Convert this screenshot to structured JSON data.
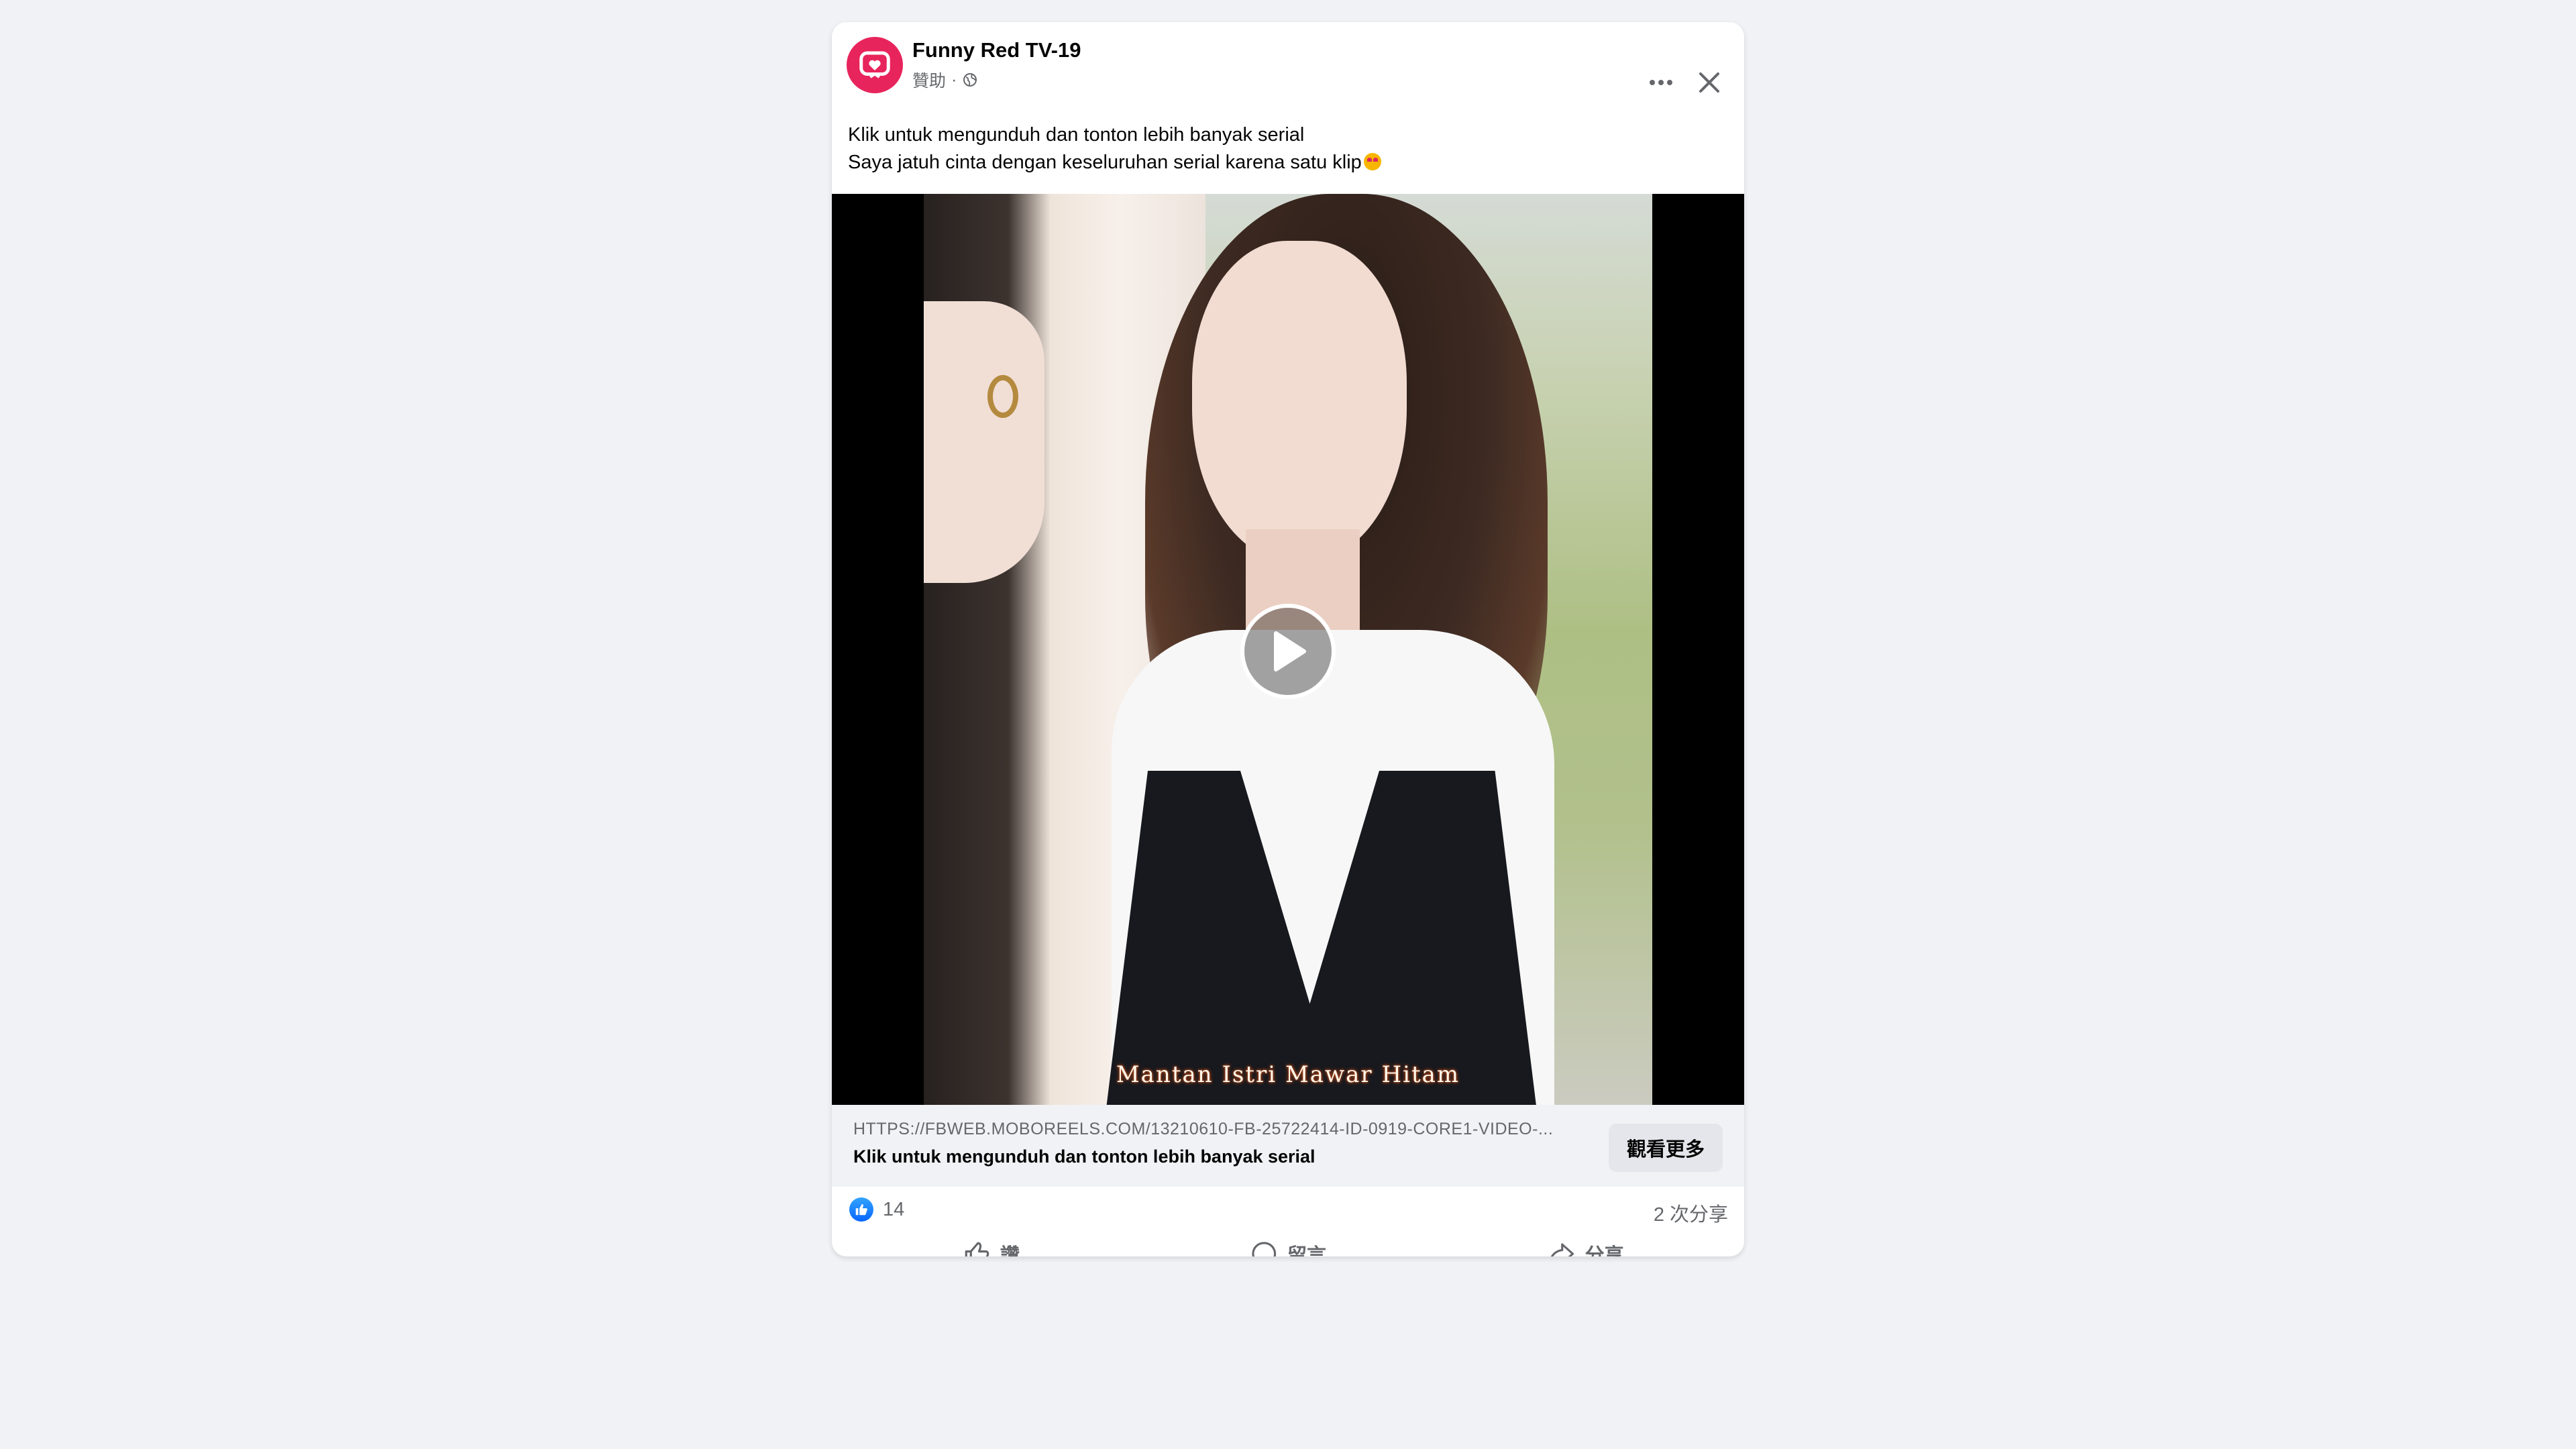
{
  "post": {
    "page_name": "Funny Red TV-19",
    "sponsored_label": "贊助",
    "meta_separator": "·",
    "caption_line1": "Klik untuk mengunduh dan tonton lebih banyak serial",
    "caption_line2": "Saya jatuh cinta dengan keseluruhan serial karena satu klip"
  },
  "video": {
    "subtitle": "Mantan Istri Mawar Hitam"
  },
  "link": {
    "url": "HTTPS://FBWEB.MOBOREELS.COM/13210610-FB-25722414-ID-0919-CORE1-VIDEO-...",
    "title": "Klik untuk mengunduh dan tonton lebih banyak serial",
    "button_label": "觀看更多"
  },
  "stats": {
    "like_count": "14",
    "share_count": "2 次分享"
  },
  "actions": {
    "like": "讚",
    "comment": "留言",
    "share": "分享"
  },
  "icons": {
    "avatar": "heart-tv-logo-icon",
    "more": "more-horizontal-icon",
    "close": "close-icon",
    "globe": "globe-icon",
    "play": "play-icon",
    "like_reaction": "thumbs-up-icon",
    "comment": "comment-icon",
    "share": "share-arrow-icon"
  },
  "colors": {
    "brand_logo": "#e8245c",
    "facebook_blue": "#0866ff",
    "secondary_text": "#65676b",
    "background": "#f0f2f5"
  }
}
